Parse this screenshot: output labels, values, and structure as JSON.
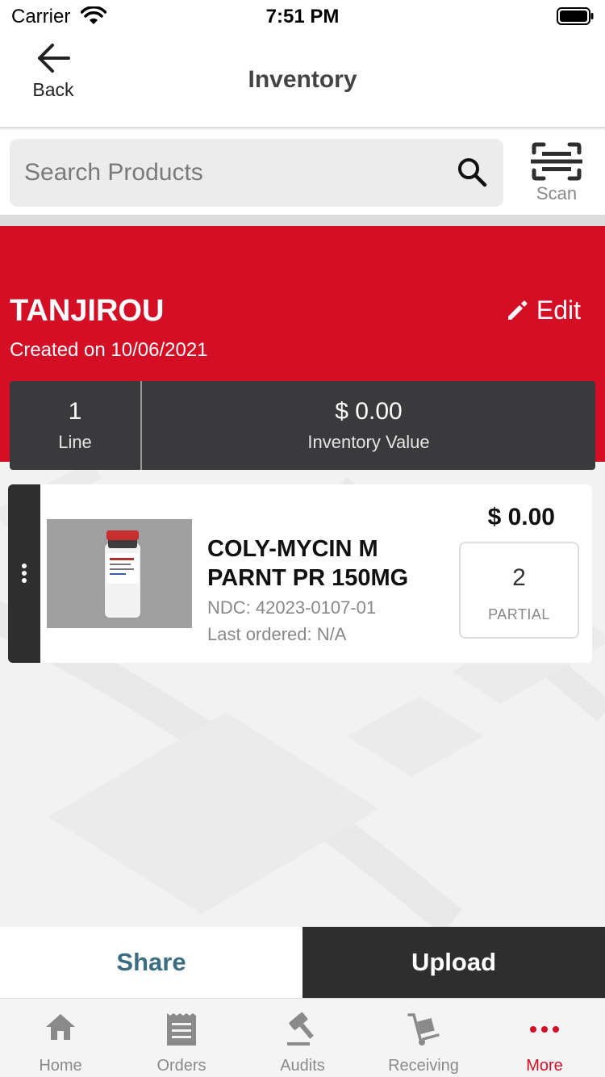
{
  "status_bar": {
    "carrier": "Carrier",
    "time": "7:51 PM"
  },
  "nav": {
    "back_label": "Back",
    "title": "Inventory"
  },
  "search": {
    "placeholder": "Search Products",
    "value": "",
    "scan_label": "Scan"
  },
  "inventory": {
    "name": "TANJIROU",
    "created": "Created on 10/06/2021",
    "edit_label": "Edit",
    "summary": {
      "lines_value": "1",
      "lines_label": "Line",
      "value_amount": "$ 0.00",
      "value_label": "Inventory Value"
    }
  },
  "items": [
    {
      "name": "COLY-MYCIN M PARNT PR 150MG",
      "ndc": "NDC: 42023-0107-01",
      "last_ordered": "Last ordered: N/A",
      "price": "$ 0.00",
      "quantity": "2",
      "unit": "PARTIAL"
    }
  ],
  "actions": {
    "share_label": "Share",
    "upload_label": "Upload"
  },
  "tabs": [
    {
      "label": "Home",
      "icon": "home-icon"
    },
    {
      "label": "Orders",
      "icon": "receipt-icon"
    },
    {
      "label": "Audits",
      "icon": "gavel-icon"
    },
    {
      "label": "Receiving",
      "icon": "dolly-icon"
    },
    {
      "label": "More",
      "icon": "more-dots-icon"
    }
  ],
  "colors": {
    "brand_red": "#d40e25",
    "dark": "#2e2e2e",
    "share_text": "#3c6e82"
  }
}
